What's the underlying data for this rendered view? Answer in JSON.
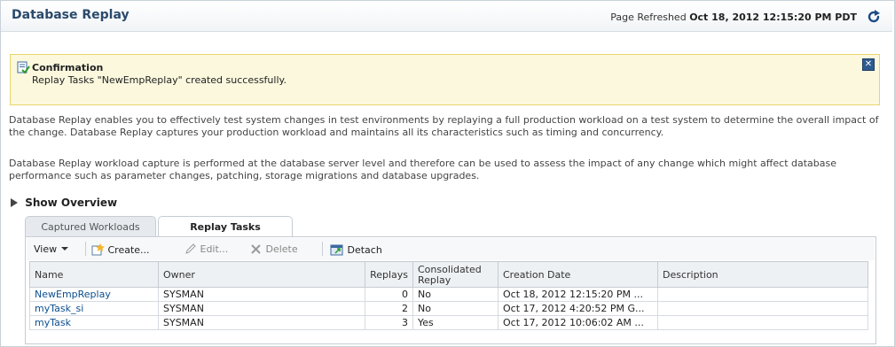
{
  "header": {
    "title": "Database Replay",
    "refresh_prefix": "Page Refreshed",
    "refresh_time": "Oct 18, 2012 12:15:20 PM PDT"
  },
  "confirmation": {
    "title": "Confirmation",
    "message": "Replay Tasks \"NewEmpReplay\" created successfully.",
    "close_symbol": "✕"
  },
  "intro": {
    "p1": "Database Replay enables you to effectively test system changes in test environments by replaying a full production workload on a test system to determine the overall impact of the change. Database Replay captures your production workload and maintains all its characteristics such as timing and concurrency.",
    "p2": "Database Replay workload capture is performed at the database server level and therefore can be used to assess the impact of any change which might affect database performance such as parameter changes, patching, storage migrations and database upgrades."
  },
  "overview_label": "Show Overview",
  "tabs": [
    {
      "label": "Captured Workloads",
      "selected": false
    },
    {
      "label": "Replay Tasks",
      "selected": true
    }
  ],
  "toolbar": {
    "view": "View",
    "create": "Create...",
    "edit": "Edit...",
    "delete": "Delete",
    "detach": "Detach"
  },
  "table": {
    "columns": [
      "Name",
      "Owner",
      "Replays",
      "Consolidated Replay",
      "Creation Date",
      "Description"
    ],
    "rows": [
      {
        "name": "NewEmpReplay",
        "owner": "SYSMAN",
        "replays": "0",
        "consolidated": "No",
        "created": "Oct 18, 2012 12:15:20 PM ...",
        "description": ""
      },
      {
        "name": "myTask_si",
        "owner": "SYSMAN",
        "replays": "2",
        "consolidated": "No",
        "created": "Oct 17, 2012 4:20:52 PM G...",
        "description": ""
      },
      {
        "name": "myTask",
        "owner": "SYSMAN",
        "replays": "3",
        "consolidated": "Yes",
        "created": "Oct 17, 2012 10:06:02 AM ...",
        "description": ""
      }
    ]
  },
  "colors": {
    "title": "#2a4a6b",
    "link": "#0b4f8f",
    "confirm_bg": "#fbf8de",
    "confirm_border": "#e8d56b"
  }
}
